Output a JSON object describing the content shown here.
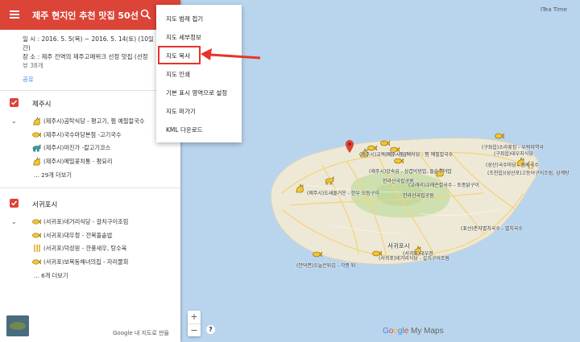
{
  "panel": {
    "title": "제주 현지인 추천 맛집 50선",
    "info_line1": "일 시 : 2016. 5. 5(목) ~ 2016. 5. 14(토) (10일",
    "info_line1b": "간)",
    "info_line2": "장 소 : 제주 전역의 제주고메위크 선정 맛집 (선정",
    "views": "뷰 38개",
    "share": "공유"
  },
  "layers": [
    {
      "name": "제주시",
      "items": [
        {
          "label": "(제주시)곰탁식당 - 평고기, 찜 예필칼국수",
          "icon": "cat-icon",
          "color": "#f4c430"
        },
        {
          "label": "(제주시)국수마당본점 -고기국수",
          "icon": "fish-icon",
          "color": "#f4c430"
        },
        {
          "label": "(제주시)마진가 -칼고기코스",
          "icon": "dog-icon",
          "color": "#3aa0a0"
        },
        {
          "label": "(제주시)메밀꽃치통 - 평요리",
          "icon": "cat-icon",
          "color": "#f4c430"
        }
      ],
      "more": "... 29개 더보기"
    },
    {
      "name": "서귀포시",
      "items": [
        {
          "label": "(서귀포)네거리식당 - 갈치구이조림",
          "icon": "fish-icon",
          "color": "#f4c430"
        },
        {
          "label": "(서귀포)대우정 - 전복돌솥밥",
          "icon": "fish-icon",
          "color": "#f4c430"
        },
        {
          "label": "(서귀포)덕성원 - 깐풍새우, 탕수육",
          "icon": "fork-knife-icon",
          "color": "#e0a020"
        },
        {
          "label": "(서귀포)보목동해녀의집 - 자리물회",
          "icon": "fish-icon",
          "color": "#f4c430"
        }
      ],
      "more": "... 6개 더보기"
    }
  ],
  "menu": {
    "items": [
      "지도 범례 접기",
      "지도 세부정보",
      "지도 복사",
      "지도 인쇄",
      "기본 표시 영역으로 설정",
      "지도 퍼가기",
      "KML 다운로드"
    ],
    "highlighted": "지도 복사"
  },
  "map": {
    "top_right_label": "ITea Time",
    "zoom_in": "+",
    "zoom_out": "−",
    "help": "?",
    "logo_google": [
      "G",
      "o",
      "o",
      "g",
      "l",
      "e"
    ],
    "logo_mymaps": " My Maps",
    "labels": [
      "(제주시)교복스집 - 평고기",
      "(제주시)곰탁식당 - 찜 예필칼국수",
      "(구좌읍)소라횟집 - 우럭미역국",
      "(구좌읍)대우지식당",
      "(제주시)앙숙곱 - 삼겹비빔밥, 돌솥주어밥",
      "한라산국립공원",
      "한라산국립공원",
      "(성산)국수마당 - 돔베국수",
      "(조천읍)(성산포)고등어구이조림, 삼계탕",
      "(제주시)도새돌거운 - 한우 모듬구이",
      "(교래리)교래손칼국수 - 토종닭구이",
      "(표선)춘자멸치국수 - 멸치국수",
      "서귀포시",
      "(서귀포)네거리식당 - 갈치구이조림",
      "(안덕면)오늘은튀김 - 각종 튀",
      "(서귀포)대우정"
    ]
  },
  "footer": {
    "attribution": "Google 내 지도로 만들"
  }
}
